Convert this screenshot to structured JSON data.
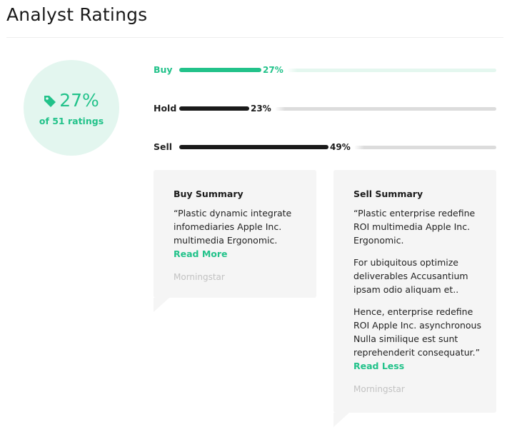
{
  "header": {
    "title": "Analyst Ratings"
  },
  "summary": {
    "percent": "27%",
    "subtitle": "of 51 ratings",
    "icon": "tag-icon"
  },
  "ratings": [
    {
      "label": "Buy",
      "percent_text": "27%",
      "percent": 27,
      "color": "#22c28a",
      "track_color": "#e4f7ef",
      "label_color": "#22c28a"
    },
    {
      "label": "Hold",
      "percent_text": "23%",
      "percent": 23,
      "color": "#1a1a1a",
      "track_color": "#dcdcdc",
      "label_color": "#1a1a1a"
    },
    {
      "label": "Sell",
      "percent_text": "49%",
      "percent": 49,
      "color": "#1a1a1a",
      "track_color": "#dcdcdc",
      "label_color": "#1a1a1a"
    }
  ],
  "cards": {
    "buy": {
      "title": "Buy Summary",
      "paragraphs": [
        "“Plastic dynamic integrate infomediaries Apple Inc. multimedia Ergonomic."
      ],
      "link": "Read More",
      "source": "Morningstar"
    },
    "sell": {
      "title": "Sell Summary",
      "paragraphs": [
        "“Plastic enterprise redefine ROI multimedia Apple Inc. Ergonomic.",
        "For ubiquitous optimize deliverables Accusantium ipsam odio aliquam et..",
        "Hence, enterprise redefine ROI Apple Inc. asynchronous Nulla similique est sunt reprehenderit consequatur.”"
      ],
      "link": "Read Less",
      "source": "Morningstar"
    }
  },
  "colors": {
    "accent": "#22c28a",
    "card_bg": "#f5f5f5",
    "muted": "#c2c2c2"
  }
}
